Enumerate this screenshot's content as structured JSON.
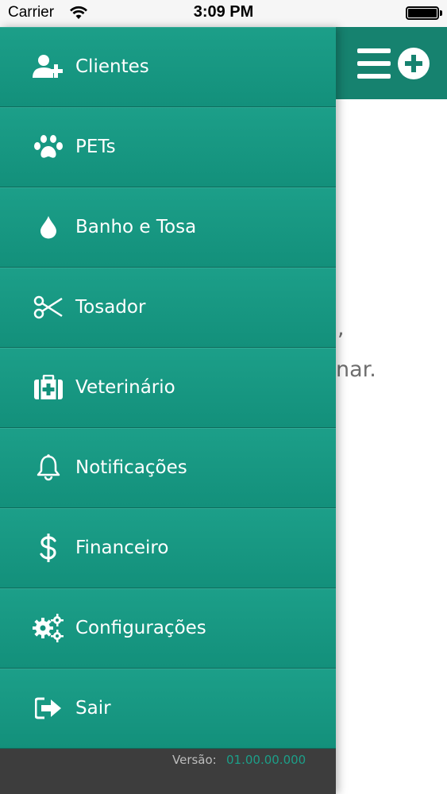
{
  "status_bar": {
    "carrier": "Carrier",
    "time": "3:09 PM"
  },
  "main": {
    "text_line1": ",",
    "text_line2": "nar."
  },
  "menu": {
    "items": [
      {
        "label": "Clientes",
        "icon": "add-user-icon"
      },
      {
        "label": "PETs",
        "icon": "paw-icon"
      },
      {
        "label": "Banho e Tosa",
        "icon": "water-drop-icon"
      },
      {
        "label": "Tosador",
        "icon": "scissors-icon"
      },
      {
        "label": "Veterinário",
        "icon": "medical-kit-icon"
      },
      {
        "label": "Notificações",
        "icon": "bell-icon"
      },
      {
        "label": "Financeiro",
        "icon": "dollar-icon"
      },
      {
        "label": "Configurações",
        "icon": "gears-icon"
      },
      {
        "label": "Sair",
        "icon": "sign-out-icon"
      }
    ]
  },
  "footer": {
    "version_label": "Versão:",
    "version_value": "01.00.00.000"
  },
  "colors": {
    "accent": "#16947f",
    "header": "#16826f",
    "footer": "#3d3d3d"
  }
}
